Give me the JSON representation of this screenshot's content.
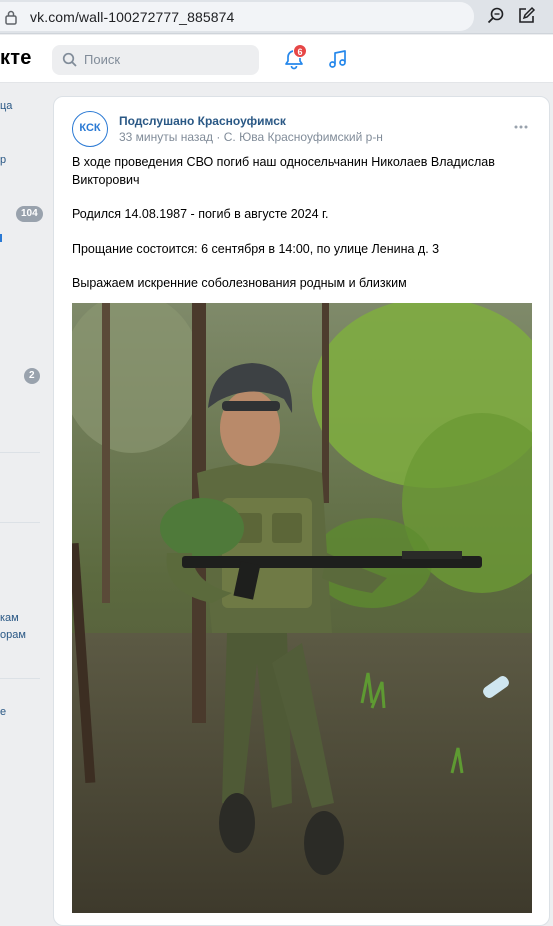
{
  "browser": {
    "url": "vk.com/wall-100272777_885874"
  },
  "header": {
    "logo": "кте",
    "search_placeholder": "Поиск",
    "notification_count": "6"
  },
  "sidebar": {
    "frag1": "ца",
    "frag2": "р",
    "count1": "104",
    "count2": "2",
    "frag3": "кам",
    "frag4": "орам",
    "frag5": "е"
  },
  "post": {
    "avatar_text": "КСК",
    "author": "Подслушано Красноуфимск",
    "time": "33 минуты назад",
    "location": "С. Юва Красноуфимский р-н",
    "separator": "·",
    "paragraphs": [
      "В ходе проведения СВО погиб наш односельчанин Николаев Владислав Викторович",
      "Родился 14.08.1987 - погиб в августе 2024 г.",
      "Прощание состоится: 6 сентября в 14:00, по улице Ленина д. 3",
      "Выражаем искренние соболезнования родным и близким"
    ]
  },
  "colors": {
    "link": "#2a5885",
    "accent": "#2a79d4",
    "badge": "#e64646"
  }
}
